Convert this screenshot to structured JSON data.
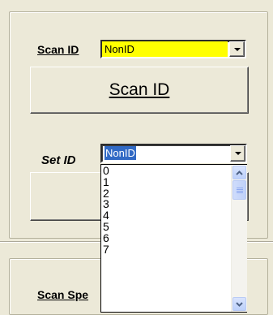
{
  "scan_id": {
    "label": "Scan ID",
    "combo_value": "NonID",
    "combo_bg": "#ffff00",
    "button_label": "Scan ID"
  },
  "set_id": {
    "label": "Set ID",
    "combo_value": "NonID",
    "options": [
      "0",
      "1",
      "2",
      "3",
      "4",
      "5",
      "6",
      "7"
    ]
  },
  "scan_speed": {
    "label": "Scan Spe"
  },
  "colors": {
    "selection": "#316ac5",
    "window": "#ece9d8"
  },
  "icons": {
    "dropdown": "chevron-down-icon",
    "scroll_up": "chevron-up-icon",
    "scroll_down": "chevron-down-icon"
  }
}
